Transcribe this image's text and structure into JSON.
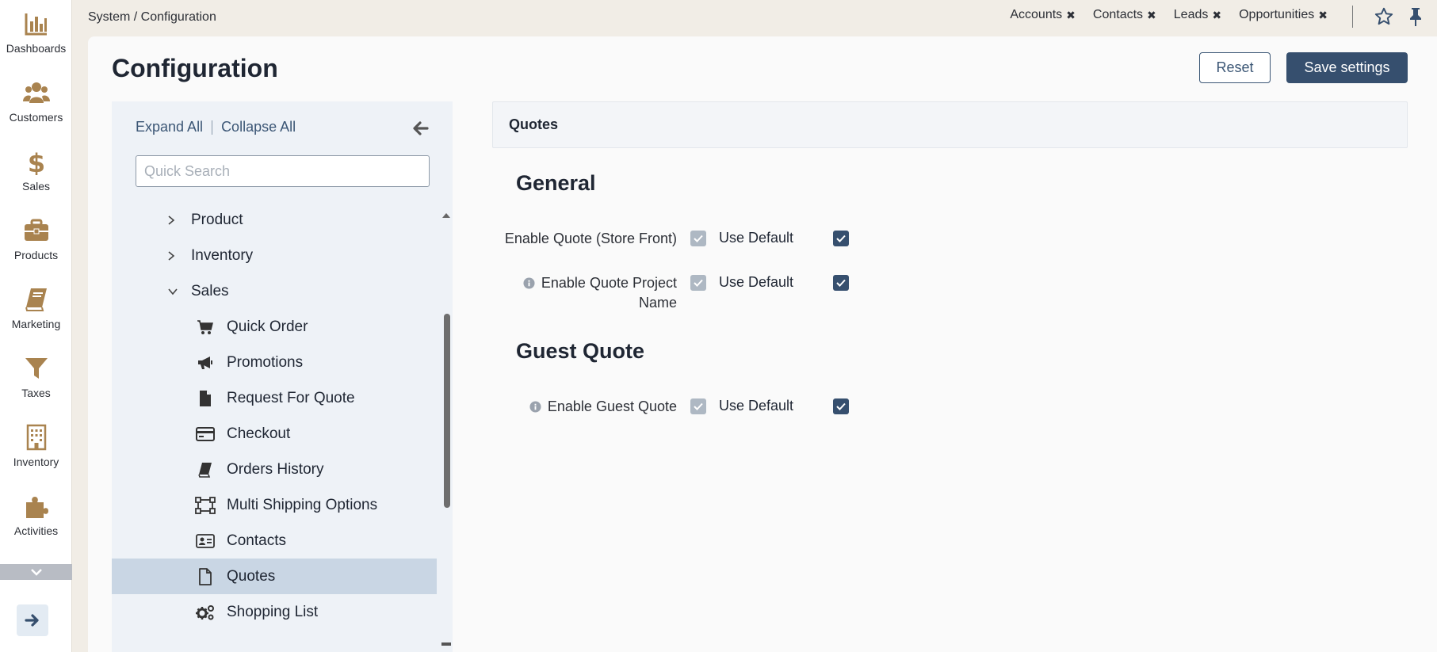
{
  "leftnav": {
    "items": [
      {
        "label": "Dashboards",
        "icon": "bar-chart-icon"
      },
      {
        "label": "Customers",
        "icon": "users-icon"
      },
      {
        "label": "Sales",
        "icon": "dollar-icon"
      },
      {
        "label": "Products",
        "icon": "briefcase-icon"
      },
      {
        "label": "Marketing",
        "icon": "book-icon"
      },
      {
        "label": "Taxes",
        "icon": "filter-icon"
      },
      {
        "label": "Inventory",
        "icon": "building-icon"
      },
      {
        "label": "Activities",
        "icon": "puzzle-icon"
      }
    ],
    "accent": "#a9834f"
  },
  "topbar": {
    "breadcrumb": "System / Configuration",
    "tabs": [
      {
        "label": "Accounts"
      },
      {
        "label": "Contacts"
      },
      {
        "label": "Leads"
      },
      {
        "label": "Opportunities"
      }
    ],
    "close_glyph": "✖"
  },
  "page": {
    "title": "Configuration",
    "reset_label": "Reset",
    "save_label": "Save settings"
  },
  "tree": {
    "expand_all": "Expand All",
    "collapse_all": "Collapse All",
    "search_placeholder": "Quick Search",
    "items": [
      {
        "label": "Product",
        "level": 1,
        "state": "collapsed"
      },
      {
        "label": "Inventory",
        "level": 1,
        "state": "collapsed"
      },
      {
        "label": "Sales",
        "level": 1,
        "state": "expanded"
      },
      {
        "label": "Quick Order",
        "level": 2,
        "icon": "cart-icon"
      },
      {
        "label": "Promotions",
        "level": 2,
        "icon": "megaphone-icon"
      },
      {
        "label": "Request For Quote",
        "level": 2,
        "icon": "file-icon"
      },
      {
        "label": "Checkout",
        "level": 2,
        "icon": "credit-card-icon"
      },
      {
        "label": "Orders History",
        "level": 2,
        "icon": "book-icon"
      },
      {
        "label": "Multi Shipping Options",
        "level": 2,
        "icon": "vector-square-icon"
      },
      {
        "label": "Contacts",
        "level": 2,
        "icon": "id-card-icon"
      },
      {
        "label": "Quotes",
        "level": 2,
        "icon": "file-outline-icon",
        "selected": true
      },
      {
        "label": "Shopping List",
        "level": 2,
        "icon": "cogs-icon"
      }
    ]
  },
  "content": {
    "section_title": "Quotes",
    "groups": [
      {
        "title": "General",
        "fields": [
          {
            "label": "Enable Quote (Store Front)",
            "info": false,
            "checked": true,
            "use_default_label": "Use Default",
            "use_default": true
          },
          {
            "label": "Enable Quote Project Name",
            "info": true,
            "checked": true,
            "use_default_label": "Use Default",
            "use_default": true
          }
        ]
      },
      {
        "title": "Guest Quote",
        "fields": [
          {
            "label": "Enable Guest Quote",
            "info": true,
            "checked": true,
            "use_default_label": "Use Default",
            "use_default": true
          }
        ]
      }
    ]
  }
}
